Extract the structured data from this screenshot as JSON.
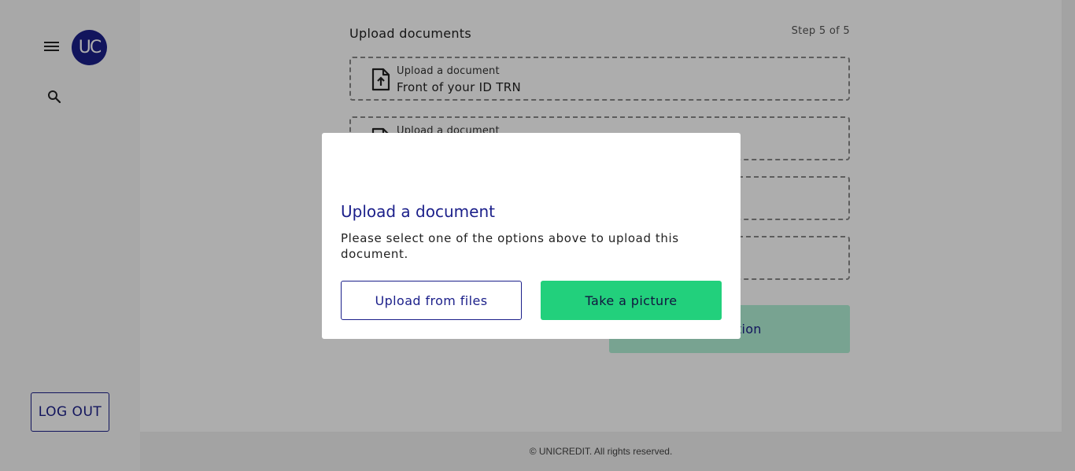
{
  "sidebar": {
    "avatar_initials": "UC",
    "menu_icon": "hamburger-menu-icon",
    "search_icon": "search-icon",
    "logout_label": "LOG OUT"
  },
  "main": {
    "title": "Upload documents",
    "step": "Step 5 of 5",
    "documents": [
      {
        "small_label": "Upload a document",
        "big_label": "Front of your ID TRN",
        "icon": "file-upload-icon"
      },
      {
        "small_label": "Upload a document",
        "big_label": "",
        "icon": "file-upload-icon"
      },
      {
        "small_label": "",
        "big_label": "",
        "icon": ""
      },
      {
        "small_label": "",
        "big_label": "",
        "icon": ""
      }
    ],
    "submit_label": "pplication"
  },
  "footer": {
    "text": "© UNICREDIT. All rights reserved."
  },
  "modal": {
    "title": "Upload a document",
    "text": "Please select one of the options above to upload this document.",
    "upload_files_label": "Upload from files",
    "take_picture_label": "Take a picture"
  },
  "colors": {
    "brand_navy": "#1b1f8a",
    "accent_green": "#22d07c",
    "overlay": "rgba(0,0,0,0.32)"
  }
}
